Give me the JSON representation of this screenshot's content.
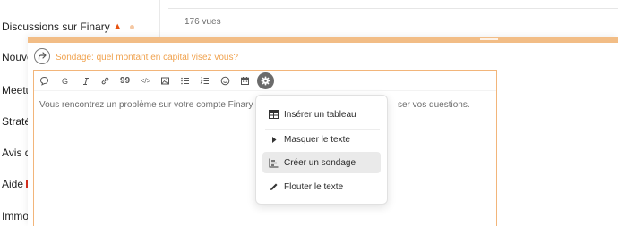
{
  "sidebar": {
    "items": [
      {
        "label": "Discussions sur Finary",
        "icon": "fire-icon"
      },
      {
        "label": "Nouvel"
      },
      {
        "label": "Meetup"
      },
      {
        "label": "Stratég"
      },
      {
        "label": "Avis de"
      },
      {
        "label": "Aide",
        "icon": "red-badge-icon"
      },
      {
        "label": "Immob"
      }
    ]
  },
  "topic": {
    "views": "176 vues"
  },
  "composer": {
    "reply_title": "Sondage: quel montant en capital visez vous?",
    "toolbar": {
      "bold_label": "G",
      "quote_label": "99",
      "code_label": "</>"
    },
    "editor_text": "Vous rencontrez un problème sur votre compte Finary ?",
    "editor_text_tail": "ser vos questions."
  },
  "popup_menu": {
    "items": [
      {
        "label": "Insérer un tableau",
        "icon": "table-icon"
      },
      {
        "label": "Masquer le texte",
        "icon": "triangle-right-icon"
      },
      {
        "label": "Créer un sondage",
        "icon": "chart-icon",
        "active": true
      },
      {
        "label": "Flouter le texte",
        "icon": "pencil-icon"
      }
    ]
  },
  "colors": {
    "accent": "#f2bd86",
    "reply_title": "#f0a24e",
    "gear_bg": "#6b6b6b"
  }
}
